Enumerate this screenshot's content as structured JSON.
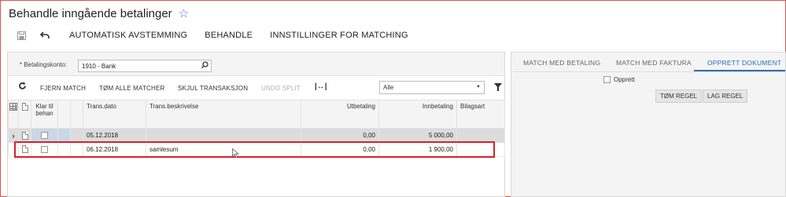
{
  "page": {
    "title": "Behandle inngående betalinger"
  },
  "toolbar": {
    "auto_reconcile": "AUTOMATISK AVSTEMMING",
    "process": "BEHANDLE",
    "match_settings": "INNSTILLINGER FOR MATCHING"
  },
  "account": {
    "label": "* Betalingskonto:",
    "value": "1910 - Bank"
  },
  "grid_toolbar": {
    "remove_match": "FJERN MATCH",
    "clear_all": "TØM ALLE MATCHER",
    "hide_transaction": "SKJUL TRANSAKSJON",
    "undo_split": "UNDO SPLIT",
    "filter_value": "Alle"
  },
  "grid": {
    "columns": {
      "ready": "Klar til behan",
      "date": "Trans.dato",
      "description": "Trans.beskrivelse",
      "payout": "Utbetaling",
      "deposit": "Innbetaling",
      "doc_type": "Bilagsart"
    },
    "rows": [
      {
        "date": "05.12.2018",
        "description": "",
        "payout": "0,00",
        "deposit": "5 000,00",
        "doc_type": ""
      },
      {
        "date": "06.12.2018",
        "description": "samlesum",
        "payout": "0,00",
        "deposit": "1 900,00",
        "doc_type": ""
      }
    ]
  },
  "right_panel": {
    "tabs": [
      "MATCH MED BETALING",
      "MATCH MED FAKTURA",
      "OPPRETT DOKUMENT"
    ],
    "active_tab": "OPPRETT DOKUMENT",
    "create_label": "Opprett",
    "clear_rule": "TØM REGEL",
    "make_rule": "LAG REGEL"
  },
  "colors": {
    "accent": "#2a6fb5",
    "highlight": "#d9202a",
    "star": "#3a7bd5"
  }
}
